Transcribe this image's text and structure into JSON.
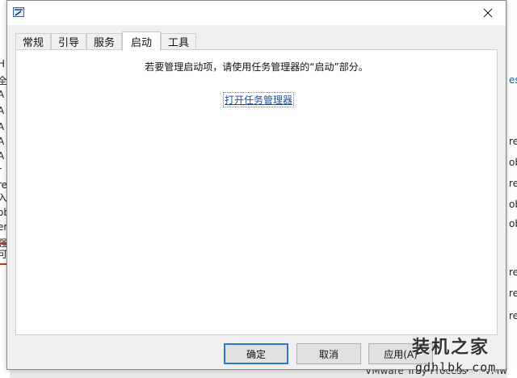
{
  "background_app": {
    "left_fragments": [
      "H",
      "全",
      "A",
      "A",
      "A",
      "A",
      "A",
      "r",
      "re",
      "入",
      "ob",
      "er",
      "强",
      "可"
    ],
    "right_fragments": [
      "es",
      "re",
      "ob",
      "re",
      "ob",
      "ob",
      "re",
      "re",
      "re"
    ],
    "bottom_text": [
      "VMware Tray Process",
      "VMw"
    ]
  },
  "dialog": {
    "tabs": [
      {
        "label": "常规"
      },
      {
        "label": "引导"
      },
      {
        "label": "服务"
      },
      {
        "label": "启动"
      },
      {
        "label": "工具"
      }
    ],
    "active_tab": "启动",
    "panel": {
      "message": "若要管理启动项，请使用任务管理器的“启动”部分。",
      "link": "打开任务管理器"
    },
    "buttons": {
      "ok": "确定",
      "cancel": "取消",
      "apply": "应用(A)"
    }
  },
  "watermark": {
    "title": "装机之家",
    "url": "gdhlbk.com"
  },
  "colors": {
    "accent": "#2b78d4",
    "link": "#1a4fa0"
  }
}
